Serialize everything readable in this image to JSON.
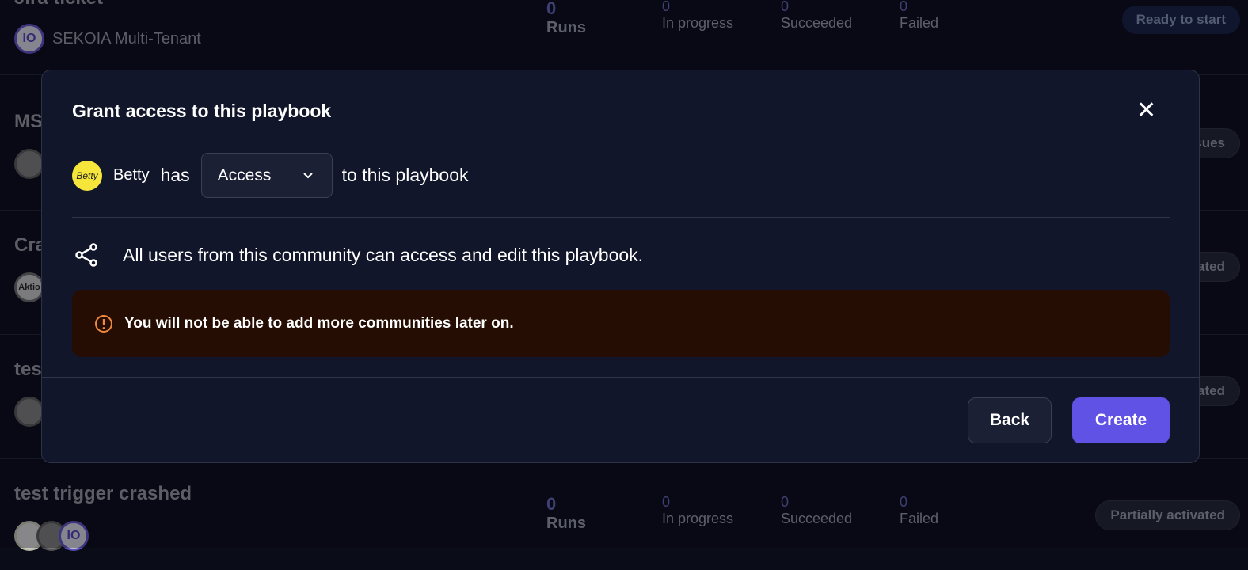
{
  "rows": [
    {
      "title": "Jira ticket",
      "community": "SEKOIA Multi-Tenant",
      "runs": "0",
      "runs_label": "Runs",
      "in_progress": "0",
      "in_progress_label": "In progress",
      "succeeded": "0",
      "succeeded_label": "Succeeded",
      "failed": "0",
      "failed_label": "Failed",
      "status": "Ready to start"
    },
    {
      "title": "MS",
      "status": "sues"
    },
    {
      "title": "Cra",
      "status": "ated",
      "avatar": "Aktio"
    },
    {
      "title": "tes",
      "status": "ated"
    },
    {
      "title": "test trigger crashed",
      "runs": "0",
      "runs_label": "Runs",
      "in_progress": "0",
      "in_progress_label": "In progress",
      "succeeded": "0",
      "succeeded_label": "Succeeded",
      "failed": "0",
      "failed_label": "Failed",
      "status": "Partially activated"
    }
  ],
  "modal": {
    "title": "Grant access to this playbook",
    "user": "Betty",
    "user_avatar": "Betty",
    "has": "has",
    "access_value": "Access",
    "suffix": "to this playbook",
    "share_text": "All users from this community can access and edit this playbook.",
    "warning": "You will not be able to add more communities later on.",
    "back": "Back",
    "create": "Create",
    "colors": {
      "primary": "#6152e6",
      "warning_bg": "#250d03",
      "warning_icon": "#f0883e"
    }
  }
}
